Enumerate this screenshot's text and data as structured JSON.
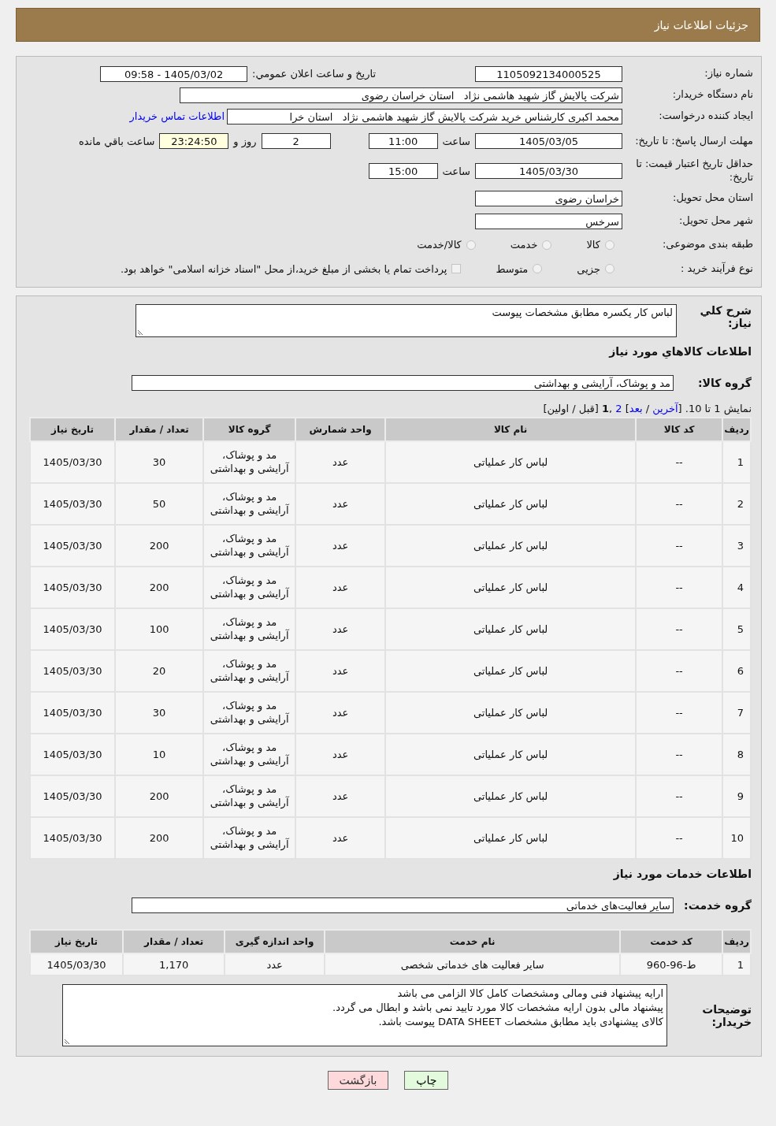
{
  "header": {
    "title": "جزئیات اطلاعات نیاز"
  },
  "info": {
    "need_number": {
      "label": "شماره نیاز:",
      "value": "1105092134000525"
    },
    "announce": {
      "label": "تاریخ و ساعت اعلان عمومي:",
      "value": "1405/03/02 - 09:58"
    },
    "buyer": {
      "label": "نام دستگاه خریدار:",
      "value": "شرکت پالایش گاز شهید هاشمی نژاد   استان خراسان رضوی"
    },
    "requester": {
      "label": "ایجاد کننده درخواست:",
      "value": "محمد اکبری کارشناس خرید شرکت پالایش گاز شهید هاشمی نژاد   استان خرا",
      "link": "اطلاعات تماس خریدار"
    },
    "reply_deadline": {
      "label": "مهلت ارسال پاسخ: تا تاریخ:",
      "date": "1405/03/05",
      "time_label": "ساعت",
      "time": "11:00",
      "days": "2",
      "days_label": "روز و",
      "remaining": "23:24:50",
      "remaining_label": "ساعت باقي مانده"
    },
    "price_validity": {
      "label": "حداقل تاریخ اعتبار قیمت: تا تاریخ:",
      "date": "1405/03/30",
      "time_label": "ساعت",
      "time": "15:00"
    },
    "province": {
      "label": "استان محل تحویل:",
      "value": "خراسان رضوی"
    },
    "city": {
      "label": "شهر محل تحویل:",
      "value": "سرخس"
    },
    "category": {
      "label": "طبقه بندی موضوعی:",
      "options": [
        {
          "label": "کالا",
          "selected": false
        },
        {
          "label": "خدمت",
          "selected": false
        },
        {
          "label": "کالا/خدمت",
          "selected": false
        }
      ]
    },
    "process": {
      "label": "نوع فرآیند خرید :",
      "options": [
        {
          "label": "جزیی",
          "selected": false
        },
        {
          "label": "متوسط",
          "selected": false
        }
      ],
      "payment": {
        "label": "پرداخت تمام یا بخشی از مبلغ خرید،از محل \"اسناد خزانه اسلامی\" خواهد بود.",
        "checked": false
      }
    }
  },
  "description": {
    "label": "شرح کلي نیاز:",
    "value": "لباس کار یکسره مطابق مشخصات پیوست"
  },
  "goods": {
    "title": "اطلاعات کالاهاي مورد نیاز",
    "group_label": "گروه کالا:",
    "group": "مد و پوشاک، آرایشی و بهداشتی",
    "pagination": [
      {
        "kind": "text",
        "text": "نمایش 1 تا 10. ["
      },
      {
        "kind": "link",
        "text": "آخرین"
      },
      {
        "kind": "text",
        "text": " / "
      },
      {
        "kind": "link",
        "text": "بعد"
      },
      {
        "kind": "text",
        "text": "] "
      },
      {
        "kind": "link",
        "text": "2"
      },
      {
        "kind": "text",
        "text": " ,"
      },
      {
        "kind": "current",
        "text": "1"
      },
      {
        "kind": "text",
        "text": " [قبل / اولین]"
      }
    ],
    "columns": [
      "ردیف",
      "کد کالا",
      "نام کالا",
      "واحد شمارش",
      "گروه کالا",
      "تعداد / مقدار",
      "تاریخ نیاز"
    ],
    "rows": [
      [
        "1",
        "--",
        "لباس کار عملیاتی",
        "عدد",
        "مد و پوشاک، آرایشی و بهداشتی",
        "30",
        "1405/03/30"
      ],
      [
        "2",
        "--",
        "لباس کار عملیاتی",
        "عدد",
        "مد و پوشاک، آرایشی و بهداشتی",
        "50",
        "1405/03/30"
      ],
      [
        "3",
        "--",
        "لباس کار عملیاتی",
        "عدد",
        "مد و پوشاک، آرایشی و بهداشتی",
        "200",
        "1405/03/30"
      ],
      [
        "4",
        "--",
        "لباس کار عملیاتی",
        "عدد",
        "مد و پوشاک، آرایشی و بهداشتی",
        "200",
        "1405/03/30"
      ],
      [
        "5",
        "--",
        "لباس کار عملیاتی",
        "عدد",
        "مد و پوشاک، آرایشی و بهداشتی",
        "100",
        "1405/03/30"
      ],
      [
        "6",
        "--",
        "لباس کار عملیاتی",
        "عدد",
        "مد و پوشاک، آرایشی و بهداشتی",
        "20",
        "1405/03/30"
      ],
      [
        "7",
        "--",
        "لباس کار عملیاتی",
        "عدد",
        "مد و پوشاک، آرایشی و بهداشتی",
        "30",
        "1405/03/30"
      ],
      [
        "8",
        "--",
        "لباس کار عملیاتی",
        "عدد",
        "مد و پوشاک، آرایشی و بهداشتی",
        "10",
        "1405/03/30"
      ],
      [
        "9",
        "--",
        "لباس کار عملیاتی",
        "عدد",
        "مد و پوشاک، آرایشی و بهداشتی",
        "200",
        "1405/03/30"
      ],
      [
        "10",
        "--",
        "لباس کار عملیاتی",
        "عدد",
        "مد و پوشاک، آرایشی و بهداشتی",
        "200",
        "1405/03/30"
      ]
    ]
  },
  "services": {
    "title": "اطلاعات خدمات مورد نیاز",
    "group_label": "گروه خدمت:",
    "group": "سایر فعالیت‌های خدماتی",
    "columns": [
      "ردیف",
      "کد خدمت",
      "نام خدمت",
      "واحد اندازه گیری",
      "تعداد / مقدار",
      "تاریخ نیاز"
    ],
    "rows": [
      [
        "1",
        "ط-96-960",
        "سایر فعالیت های خدماتی شخصی",
        "عدد",
        "1,170",
        "1405/03/30"
      ]
    ]
  },
  "notes": {
    "label": "توضیحات خریدار:",
    "lines": [
      "ارایه پیشنهاد فنی ومالی ومشخصات کامل کالا الزامی می باشد",
      "پیشنهاد مالی بدون ارایه مشخصات کالا مورد تایید نمی باشد و ابطال می گردد.",
      "کالای پیشنهادی باید مطابق مشخصات DATA SHEET پیوست باشد."
    ]
  },
  "buttons": [
    {
      "kind": "print",
      "label": "چاپ"
    },
    {
      "kind": "back",
      "label": "بازگشت"
    }
  ]
}
